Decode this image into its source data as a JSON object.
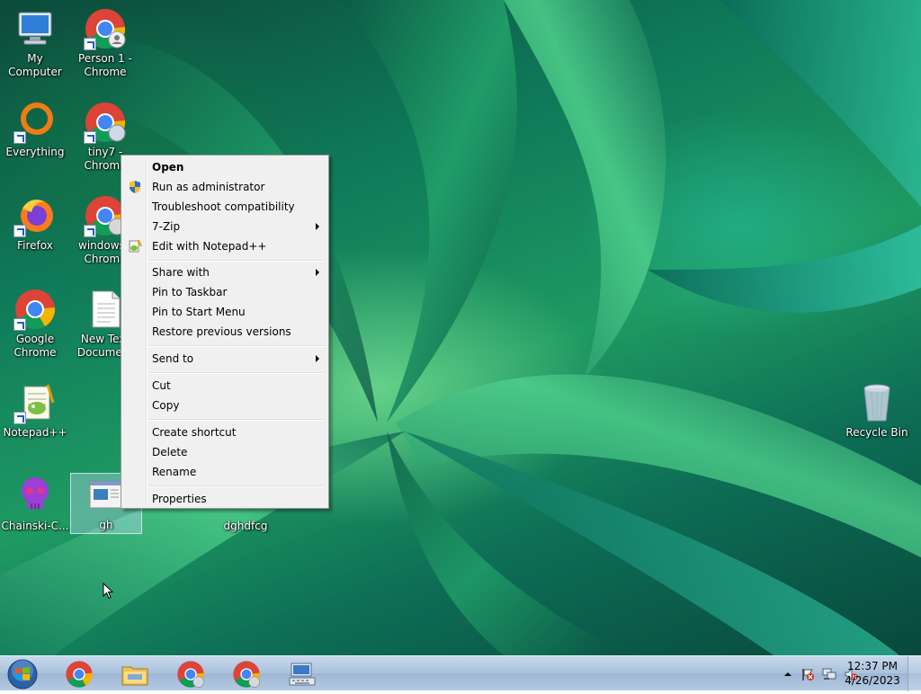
{
  "desktop": {
    "icons": [
      {
        "label": "My Computer",
        "icon": "my-computer-icon"
      },
      {
        "label": "Person 1 - Chrome",
        "icon": "chrome-profile-icon"
      },
      {
        "label": "Everything",
        "icon": "everything-icon"
      },
      {
        "label": "tiny7 - Chrome",
        "icon": "chrome-profile-icon"
      },
      {
        "label": "Firefox",
        "icon": "firefox-icon"
      },
      {
        "label": "windows - Chrome",
        "icon": "chrome-profile-icon"
      },
      {
        "label": "Google Chrome",
        "icon": "chrome-icon"
      },
      {
        "label": "New Text Document",
        "icon": "text-document-icon"
      },
      {
        "label": "Notepad++",
        "icon": "notepadpp-icon"
      },
      {
        "label": "Chainski-C...",
        "icon": "skull-icon"
      },
      {
        "label": "gh",
        "icon": "app-window-icon"
      },
      {
        "label": "dghdfcg",
        "icon": "blank-icon"
      },
      {
        "label": "Recycle Bin",
        "icon": "recycle-bin-icon"
      }
    ]
  },
  "context_menu": {
    "items": [
      {
        "label": "Open",
        "bold": true
      },
      {
        "label": "Run as administrator",
        "icon": "uac-shield-icon"
      },
      {
        "label": "Troubleshoot compatibility"
      },
      {
        "label": "7-Zip",
        "submenu": true
      },
      {
        "label": "Edit with Notepad++",
        "icon": "notepadpp-icon"
      },
      {
        "label": "Share with",
        "submenu": true
      },
      {
        "label": "Pin to Taskbar"
      },
      {
        "label": "Pin to Start Menu"
      },
      {
        "label": "Restore previous versions"
      },
      {
        "label": "Send to",
        "submenu": true
      },
      {
        "label": "Cut"
      },
      {
        "label": "Copy"
      },
      {
        "label": "Create shortcut"
      },
      {
        "label": "Delete"
      },
      {
        "label": "Rename"
      },
      {
        "label": "Properties"
      }
    ]
  },
  "taskbar": {
    "buttons": [
      "start-orb-icon",
      "chrome-icon",
      "file-explorer-icon",
      "chrome-profile-icon",
      "chrome-profile-icon",
      "keyboard-icon"
    ],
    "tray": {
      "icons": [
        "show-hidden-icons-arrow",
        "action-center-flag-icon",
        "network-icon",
        "volume-muted-icon"
      ],
      "time": "12:37 PM",
      "date": "4/26/2023"
    }
  },
  "colors": {
    "menu_bg": "#f0f0f0",
    "taskbar_bg": "#b4cae3",
    "selection_bg": "#c8e1ff"
  }
}
